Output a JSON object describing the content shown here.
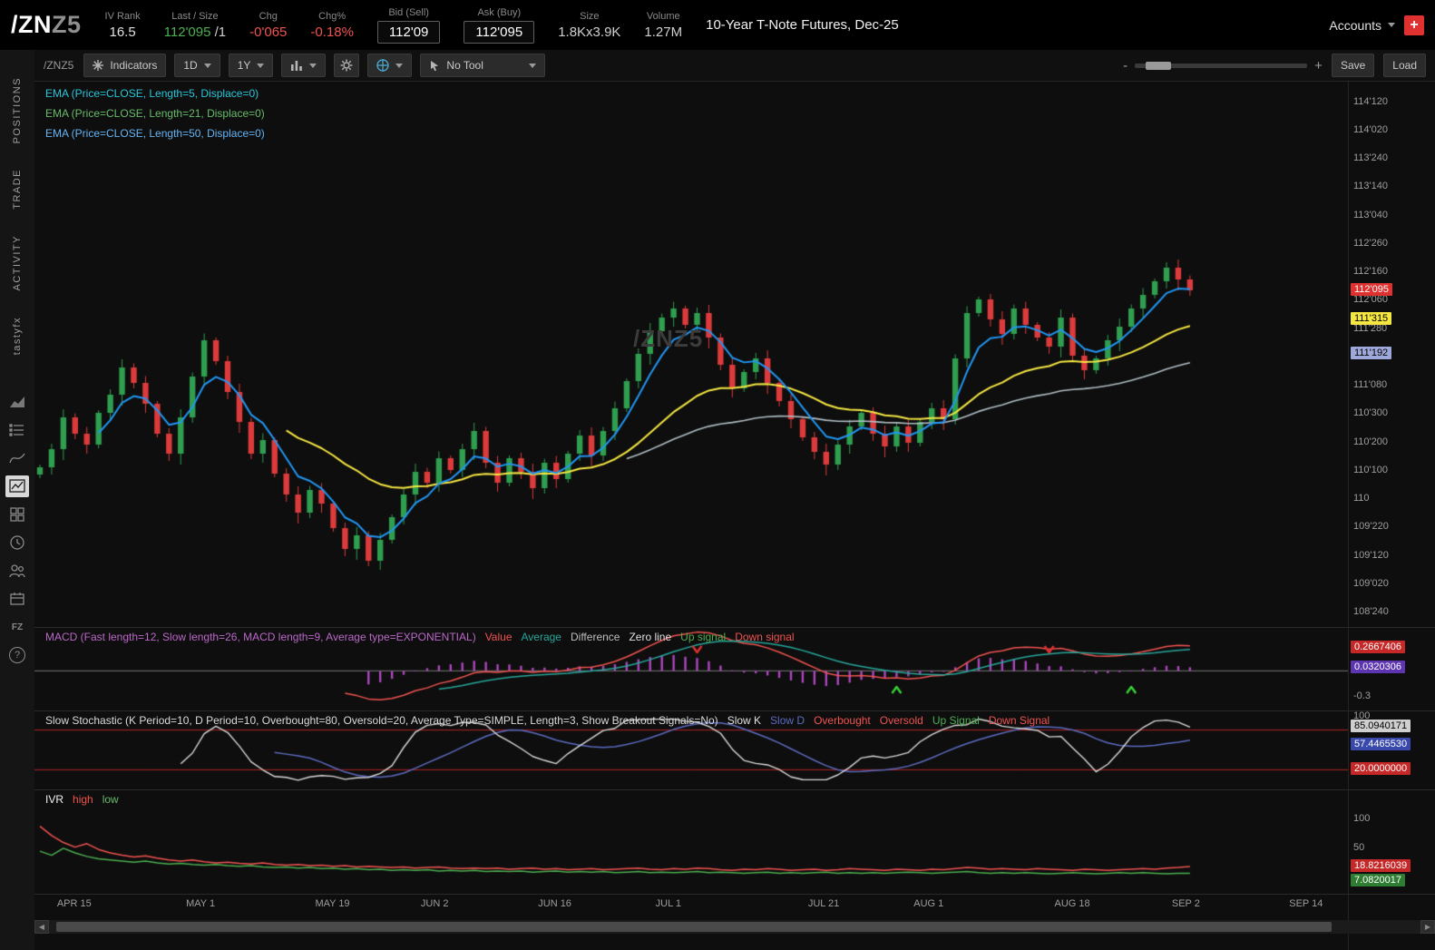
{
  "header": {
    "symbol": "/ZN",
    "symbol_suffix": "Z5",
    "fields": [
      {
        "label": "IV Rank",
        "value": "16.5",
        "color": "#e0e0e0"
      },
      {
        "label": "Last / Size",
        "value": "112'095",
        "extra": " /1",
        "color": "#4caf50"
      },
      {
        "label": "Chg",
        "value": "-0'065",
        "color": "#ef5350"
      },
      {
        "label": "Chg%",
        "value": "-0.18%",
        "color": "#ef5350"
      },
      {
        "label": "Bid (Sell)",
        "value": "112'09",
        "boxed": true,
        "color": "#ffffff"
      },
      {
        "label": "Ask (Buy)",
        "value": "112'095",
        "boxed": true,
        "color": "#ffffff"
      },
      {
        "label": "Size",
        "value": "1.8Kx3.9K",
        "color": "#cfcfcf"
      },
      {
        "label": "Volume",
        "value": "1.27M",
        "color": "#cfcfcf"
      }
    ],
    "description": "10-Year T-Note Futures, Dec-25",
    "accounts_label": "Accounts",
    "add_button": "+"
  },
  "rail": {
    "tabs": [
      "POSITIONS",
      "TRADE",
      "ACTIVITY",
      "tastyfx"
    ],
    "fz": "FZ",
    "help": "?"
  },
  "toolbar": {
    "symbol": "/ZNZ5",
    "indicators": "Indicators",
    "timeframe": "1D",
    "range": "1Y",
    "tool": "No Tool",
    "save": "Save",
    "load": "Load",
    "zoom_minus": "-",
    "zoom_plus": "+"
  },
  "price_panel": {
    "studies": [
      {
        "label": "EMA (Price=CLOSE, Length=5, Displace=0)",
        "color": "#26c6da"
      },
      {
        "label": "EMA (Price=CLOSE, Length=21, Displace=0)",
        "color": "#66bb6a"
      },
      {
        "label": "EMA (Price=CLOSE, Length=50, Displace=0)",
        "color": "#64b5f6"
      }
    ],
    "watermark": "/ZNZ5",
    "axis": [
      {
        "t": "114'120",
        "v": 114.375
      },
      {
        "t": "114'020",
        "v": 114.0625
      },
      {
        "t": "113'240",
        "v": 113.75
      },
      {
        "t": "113'140",
        "v": 113.4375
      },
      {
        "t": "113'040",
        "v": 113.125
      },
      {
        "t": "112'260",
        "v": 112.8125
      },
      {
        "t": "112'160",
        "v": 112.5
      },
      {
        "t": "112'060",
        "v": 112.1875
      },
      {
        "t": "111'280",
        "v": 111.875
      },
      {
        "t": "111'080",
        "v": 111.25
      },
      {
        "t": "110'300",
        "v": 110.9375
      },
      {
        "t": "110'200",
        "v": 110.625
      },
      {
        "t": "110'100",
        "v": 110.3125
      },
      {
        "t": "110",
        "v": 110.0
      },
      {
        "t": "109'220",
        "v": 109.6875
      },
      {
        "t": "109'120",
        "v": 109.375
      },
      {
        "t": "109'020",
        "v": 109.0625
      },
      {
        "t": "108'240",
        "v": 108.75
      }
    ],
    "badges": [
      {
        "label": "112'095",
        "v": 112.297,
        "bg": "#e03131",
        "fg": "#ffffff"
      },
      {
        "label": "111'315",
        "v": 111.984,
        "bg": "#f5e642",
        "fg": "#000000"
      },
      {
        "label": "111'192",
        "v": 111.6,
        "bg": "#9fa8da",
        "fg": "#000000"
      }
    ]
  },
  "macd_panel": {
    "title": "MACD (Fast length=12, Slow length=26, MACD length=9, Average type=EXPONENTIAL)",
    "title_color": "#ba68c8",
    "legend": [
      {
        "label": "Value",
        "color": "#ef5350"
      },
      {
        "label": "Average",
        "color": "#26a69a"
      },
      {
        "label": "Difference",
        "color": "#bdbdbd"
      },
      {
        "label": "Zero line",
        "color": "#e0e0e0"
      },
      {
        "label": "Up signal",
        "color": "#4caf50"
      },
      {
        "label": "Down signal",
        "color": "#ef5350"
      }
    ],
    "axis": [
      {
        "t": "-0.3",
        "v": -0.3
      }
    ],
    "badges": [
      {
        "label": "0.2667406",
        "v": 0.2667406,
        "bg": "#c62828",
        "fg": "#ffffff"
      },
      {
        "label": "0.0320306",
        "v": 0.0320306,
        "bg": "#5e35b1",
        "fg": "#ffffff"
      }
    ]
  },
  "stoch_panel": {
    "title": "Slow Stochastic (K Period=10, D Period=10, Overbought=80, Oversold=20, Average Type=SIMPLE, Length=3, Show Breakout Signals=No)",
    "title_color": "#d9d9d9",
    "legend": [
      {
        "label": "Slow K",
        "color": "#e0e0e0"
      },
      {
        "label": "Slow D",
        "color": "#5c6bc0"
      },
      {
        "label": "Overbought",
        "color": "#ef5350"
      },
      {
        "label": "Oversold",
        "color": "#ef5350"
      },
      {
        "label": "Up Signal",
        "color": "#4caf50"
      },
      {
        "label": "Down Signal",
        "color": "#ef5350"
      }
    ],
    "axis": [
      {
        "t": "100",
        "v": 100
      }
    ],
    "badges": [
      {
        "label": "85.0940171",
        "v": 85.0940171,
        "bg": "#cfcfcf",
        "fg": "#000000"
      },
      {
        "label": "57.4465530",
        "v": 57.446553,
        "bg": "#3949ab",
        "fg": "#ffffff"
      },
      {
        "label": "20.0000000",
        "v": 20.0,
        "bg": "#c62828",
        "fg": "#ffffff"
      }
    ]
  },
  "ivr_panel": {
    "legend": [
      {
        "label": "IVR",
        "color": "#f0f0f0"
      },
      {
        "label": "high",
        "color": "#ef5350"
      },
      {
        "label": "low",
        "color": "#66bb6a"
      }
    ],
    "axis": [
      {
        "t": "100",
        "v": 100
      },
      {
        "t": "50",
        "v": 50
      }
    ],
    "badges": [
      {
        "label": "18.8216039",
        "v": 18.8216039,
        "bg": "#c62828",
        "fg": "#ffffff"
      },
      {
        "label": "7.0820017",
        "v": 7.08,
        "bg": "#2e7d32",
        "fg": "#ffffff"
      }
    ]
  },
  "chart_data": {
    "type": "candlestick",
    "symbol": "/ZNZ5",
    "title": "10-Year T-Note Futures, Dec-25",
    "price_axis_range": [
      108.6,
      114.6
    ],
    "macd_range": [
      -0.45,
      0.5
    ],
    "stoch_range": [
      0,
      100
    ],
    "stoch_overbought": 80,
    "stoch_oversold": 20,
    "closes": [
      110.35,
      110.55,
      110.9,
      110.72,
      110.6,
      110.95,
      111.15,
      111.45,
      111.28,
      111.05,
      110.72,
      110.5,
      110.9,
      111.35,
      111.75,
      111.52,
      111.18,
      110.85,
      110.5,
      110.65,
      110.28,
      110.05,
      109.85,
      110.1,
      109.95,
      109.68,
      109.45,
      109.6,
      109.32,
      109.55,
      109.8,
      110.05,
      110.3,
      110.18,
      110.45,
      110.32,
      110.55,
      110.75,
      110.4,
      110.18,
      110.45,
      110.3,
      110.12,
      110.4,
      110.22,
      110.5,
      110.7,
      110.48,
      110.75,
      111.0,
      111.3,
      111.6,
      111.85,
      112.0,
      112.1,
      111.92,
      112.05,
      111.78,
      111.48,
      111.22,
      111.4,
      111.55,
      111.28,
      111.08,
      110.88,
      110.68,
      110.52,
      110.38,
      110.6,
      110.8,
      110.95,
      110.72,
      110.58,
      110.8,
      110.62,
      110.85,
      111.0,
      110.88,
      111.55,
      112.05,
      112.2,
      111.98,
      111.82,
      112.1,
      111.92,
      111.78,
      111.68,
      112.0,
      111.58,
      111.42,
      111.55,
      111.75,
      111.9,
      112.1,
      112.25,
      112.4,
      112.55,
      112.42,
      112.3
    ],
    "ivr_high": [
      88,
      72,
      60,
      52,
      58,
      48,
      42,
      38,
      35,
      37,
      33,
      30,
      28,
      30,
      27,
      25,
      26,
      24,
      23,
      25,
      22,
      21,
      22,
      20,
      21,
      19,
      20,
      18,
      19,
      18,
      17,
      18,
      16,
      17,
      18,
      16,
      15,
      16,
      15,
      16,
      14,
      15,
      16,
      14,
      15,
      13,
      14,
      15,
      13,
      14,
      15,
      16,
      14,
      13,
      15,
      14,
      16,
      15,
      13,
      12,
      14,
      13,
      15,
      14,
      12,
      13,
      14,
      12,
      13,
      15,
      14,
      13,
      12,
      14,
      13,
      12,
      14,
      13,
      15,
      17,
      16,
      14,
      15,
      14,
      13,
      15,
      14,
      13,
      12,
      14,
      13,
      12,
      13,
      14,
      15,
      14,
      16,
      17,
      18.8
    ],
    "ivr_low": [
      45,
      38,
      50,
      42,
      36,
      32,
      30,
      28,
      26,
      28,
      25,
      23,
      24,
      22,
      21,
      22,
      20,
      19,
      20,
      18,
      17,
      18,
      16,
      17,
      15,
      16,
      14,
      15,
      13,
      14,
      12,
      13,
      12,
      13,
      11,
      12,
      11,
      12,
      10,
      11,
      10,
      11,
      9,
      10,
      11,
      9,
      10,
      9,
      10,
      8,
      9,
      10,
      8,
      9,
      8,
      9,
      10,
      8,
      9,
      8,
      7,
      8,
      9,
      7,
      8,
      7,
      8,
      9,
      7,
      8,
      7,
      8,
      7,
      8,
      9,
      8,
      7,
      8,
      9,
      10,
      8,
      7,
      8,
      7,
      8,
      7,
      6,
      7,
      8,
      7,
      6,
      7,
      8,
      7,
      8,
      7,
      6,
      7,
      7.1
    ],
    "x_ticks": [
      {
        "label": "APR 15",
        "i": 3
      },
      {
        "label": "MAY 1",
        "i": 14
      },
      {
        "label": "MAY 19",
        "i": 25
      },
      {
        "label": "JUN 2",
        "i": 34
      },
      {
        "label": "JUN 16",
        "i": 44
      },
      {
        "label": "JUL 1",
        "i": 54
      },
      {
        "label": "JUL 21",
        "i": 67
      },
      {
        "label": "AUG 1",
        "i": 76
      },
      {
        "label": "AUG 18",
        "i": 88
      },
      {
        "label": "SEP 2",
        "i": 98
      },
      {
        "label": "SEP 14",
        "i": 108
      }
    ],
    "macd_up_signal_indices": [
      73,
      93
    ],
    "macd_down_signal_indices": [
      56,
      86
    ],
    "colors": {
      "up": "#2f9e4f",
      "down": "#dd3b3b",
      "ema5": "#2196f3",
      "ema21": "#f5e642",
      "ema50": "#b0bec5",
      "macd_value": "#ef5350",
      "macd_avg": "#26a69a",
      "macd_hist": "#ab47bc",
      "stoch_k": "#d9d9d9",
      "stoch_d": "#5c6bc0",
      "stoch_bands": "#b02525",
      "ivr_high": "#ef5350",
      "ivr_low": "#4caf50",
      "zero_line": "#777777"
    }
  }
}
